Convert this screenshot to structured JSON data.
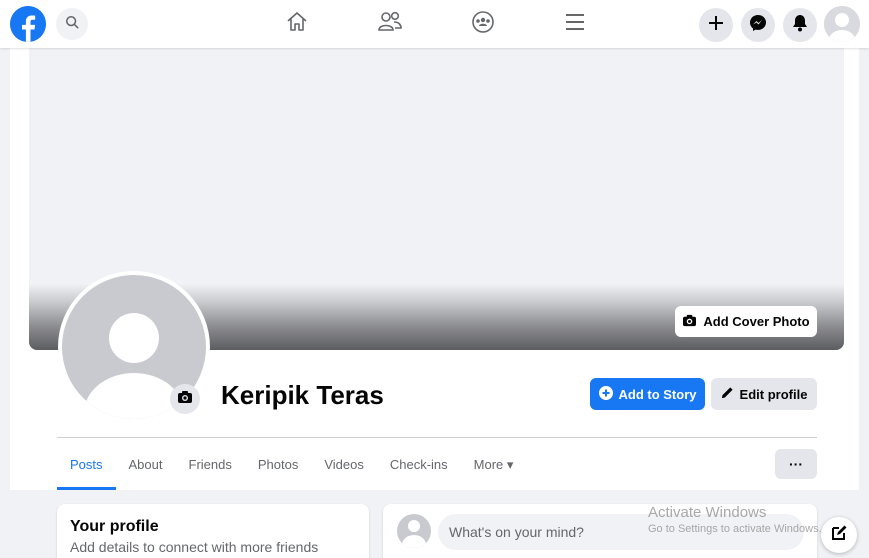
{
  "nav": {
    "logo_letter": "f",
    "icons": [
      "search-icon",
      "home-icon",
      "friends-icon",
      "groups-icon",
      "menu-icon",
      "plus-icon",
      "messenger-icon",
      "notifications-icon",
      "account-avatar"
    ]
  },
  "cover": {
    "add_cover_label": "Add Cover Photo"
  },
  "profile": {
    "name": "Keripik Teras",
    "add_story_label": "Add to Story",
    "edit_profile_label": "Edit profile"
  },
  "tabs": [
    {
      "label": "Posts",
      "active": true
    },
    {
      "label": "About",
      "active": false
    },
    {
      "label": "Friends",
      "active": false
    },
    {
      "label": "Photos",
      "active": false
    },
    {
      "label": "Videos",
      "active": false
    },
    {
      "label": "Check-ins",
      "active": false
    },
    {
      "label": "More ▾",
      "active": false
    }
  ],
  "more_dots": "···",
  "your_profile": {
    "title": "Your profile",
    "subtitle": "Add details to connect with more friends"
  },
  "composer": {
    "placeholder": "What's on your mind?"
  },
  "watermark": {
    "line1": "Activate Windows",
    "line2": "Go to Settings to activate Windows."
  },
  "colors": {
    "brand": "#1877f2",
    "background": "#f0f2f5",
    "secondary_button": "#e4e6eb"
  }
}
